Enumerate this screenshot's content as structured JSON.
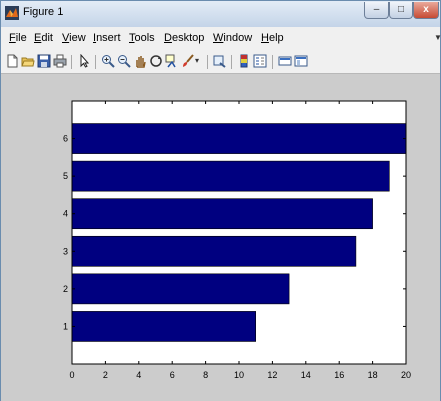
{
  "window": {
    "title": "Figure 1",
    "min_label": "–",
    "max_label": "□",
    "close_label": "x"
  },
  "menu": [
    {
      "u": "F",
      "rest": "ile"
    },
    {
      "u": "E",
      "rest": "dit"
    },
    {
      "u": "V",
      "rest": "iew"
    },
    {
      "u": "I",
      "rest": "nsert"
    },
    {
      "u": "T",
      "rest": "ools"
    },
    {
      "u": "D",
      "rest": "esktop"
    },
    {
      "u": "W",
      "rest": "indow"
    },
    {
      "u": "H",
      "rest": "elp"
    }
  ],
  "toolbar_icons": [
    "new-file-icon",
    "open-folder-icon",
    "save-icon",
    "print-icon",
    "pointer-icon",
    "zoom-in-icon",
    "zoom-out-icon",
    "pan-icon",
    "rotate-3d-icon",
    "data-cursor-icon",
    "brush-icon",
    "brush-dropdown-icon",
    "link-plot-icon",
    "colorbar-icon",
    "legend-icon",
    "hide-plot-tools-icon",
    "show-plot-tools-icon"
  ],
  "colors": {
    "bar": "#000080",
    "figure_bg": "#cccccc",
    "axes_bg": "#ffffff"
  },
  "chart_data": {
    "type": "bar",
    "orientation": "horizontal",
    "categories": [
      "1",
      "2",
      "3",
      "4",
      "5",
      "6"
    ],
    "values": [
      11,
      13,
      17,
      18,
      19,
      20
    ],
    "xlim": [
      0,
      20
    ],
    "xticks": [
      "0",
      "2",
      "4",
      "6",
      "8",
      "10",
      "12",
      "14",
      "16",
      "18",
      "20"
    ],
    "yticks": [
      "1",
      "2",
      "3",
      "4",
      "5",
      "6"
    ],
    "title": "",
    "xlabel": "",
    "ylabel": "",
    "grid": false
  }
}
